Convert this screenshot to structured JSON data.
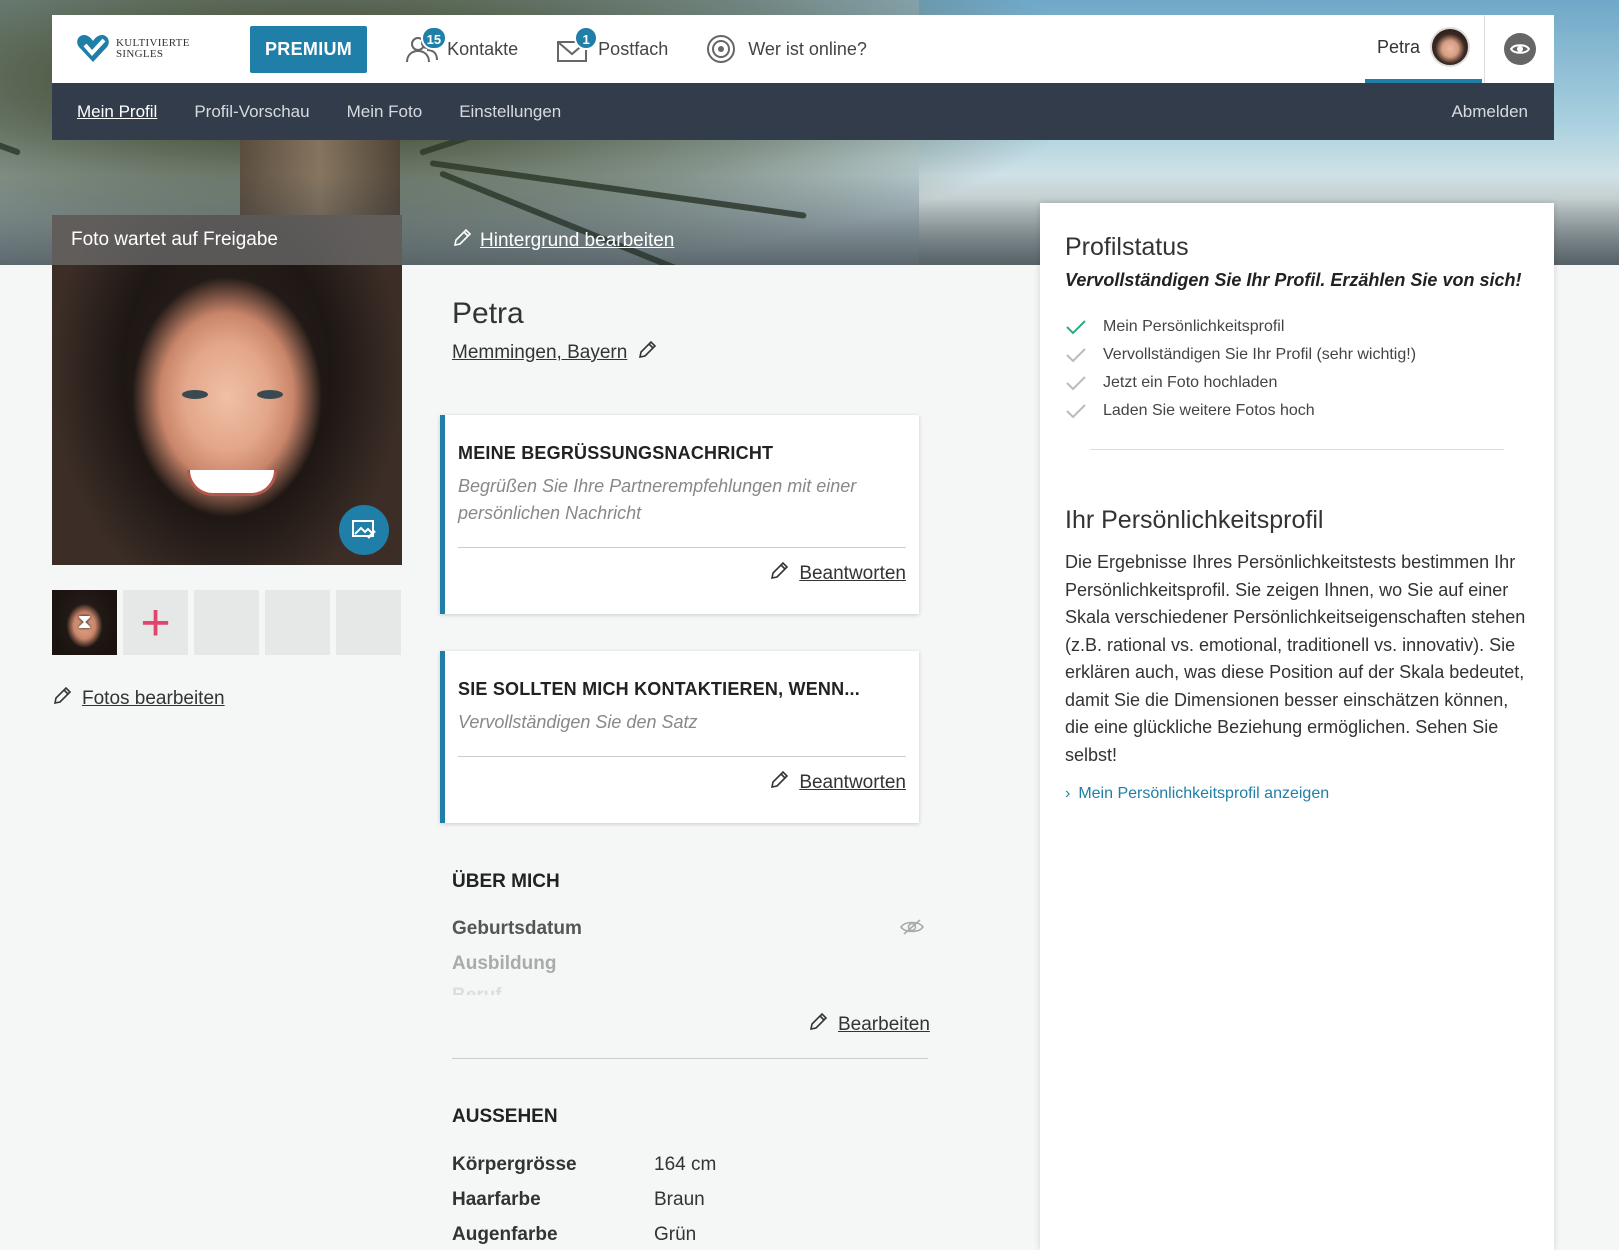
{
  "brand": {
    "line1": "KULTIVIERTE",
    "line2": "SINGLES",
    "accent": "#1f7fa8"
  },
  "topnav": {
    "premium": "PREMIUM",
    "contacts_label": "Kontakte",
    "contacts_badge": "15",
    "inbox_label": "Postfach",
    "inbox_badge": "1",
    "online_label": "Wer ist online?",
    "user_name": "Petra"
  },
  "subnav": {
    "items": [
      "Mein Profil",
      "Profil-Vorschau",
      "Mein Foto",
      "Einstellungen"
    ],
    "logout": "Abmelden"
  },
  "left": {
    "pending": "Foto wartet auf Freigabe",
    "edit_photos": "Fotos bearbeiten"
  },
  "profile": {
    "edit_background": "Hintergrund bearbeiten",
    "name": "Petra",
    "location": "Memmingen, Bayern"
  },
  "cards": [
    {
      "title": "MEINE BEGRÜSSUNGSNACHRICHT",
      "desc": "Begrüßen Sie Ihre Partnerempfehlungen mit einer persönlichen Nachricht",
      "action": "Beantworten"
    },
    {
      "title": "SIE SOLLTEN MICH KONTAKTIEREN, WENN...",
      "desc": "Vervollständigen Sie den Satz",
      "action": "Beantworten"
    }
  ],
  "about": {
    "title": "ÜBER MICH",
    "fields": [
      "Geburtsdatum",
      "Ausbildung",
      "Beruf"
    ],
    "edit": "Bearbeiten"
  },
  "looks": {
    "title": "AUSSEHEN",
    "rows": [
      {
        "label": "Körpergrösse",
        "value": "164 cm"
      },
      {
        "label": "Haarfarbe",
        "value": "Braun"
      },
      {
        "label": "Augenfarbe",
        "value": "Grün"
      }
    ]
  },
  "status": {
    "title": "Profilstatus",
    "subtitle": "Vervollständigen Sie Ihr Profil. Erzählen Sie von sich!",
    "items": [
      {
        "text": "Mein Persönlichkeitsprofil",
        "done": true
      },
      {
        "text": "Vervollständigen Sie Ihr Profil (sehr wichtig!)",
        "done": false
      },
      {
        "text": "Jetzt ein Foto hochladen",
        "done": false
      },
      {
        "text": "Laden Sie weitere Fotos hoch",
        "done": false
      }
    ]
  },
  "personality": {
    "title": "Ihr Persönlichkeitsprofil",
    "body": "Die Ergebnisse Ihres Persönlichkeitstests bestimmen Ihr Persönlichkeitsprofil. Sie zeigen Ihnen, wo Sie auf einer Skala verschiedener Persönlichkeitseigenschaften stehen (z.B. rational vs. emotional, traditionell vs. innovativ). Sie erklären auch, was diese Position auf der Skala bedeutet, damit Sie die Dimensionen besser einschätzen können, die eine glückliche Beziehung ermöglichen. Sehen Sie selbst!",
    "link": "Mein Persönlichkeitsprofil anzeigen"
  }
}
